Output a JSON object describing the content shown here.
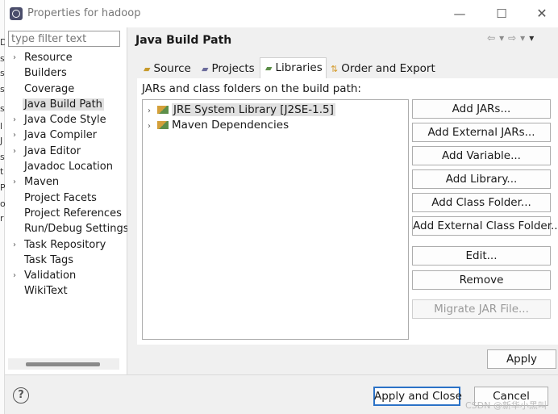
{
  "window": {
    "title": "Properties for hadoop"
  },
  "titlebar_controls": {
    "minimize": "—",
    "maximize": "☐",
    "close": "✕"
  },
  "filter": {
    "placeholder": "type filter text"
  },
  "tree": [
    {
      "label": "Resource",
      "arrow": "›"
    },
    {
      "label": "Builders",
      "arrow": ""
    },
    {
      "label": "Coverage",
      "arrow": ""
    },
    {
      "label": "Java Build Path",
      "arrow": "",
      "selected": true
    },
    {
      "label": "Java Code Style",
      "arrow": "›"
    },
    {
      "label": "Java Compiler",
      "arrow": "›"
    },
    {
      "label": "Java Editor",
      "arrow": "›"
    },
    {
      "label": "Javadoc Location",
      "arrow": ""
    },
    {
      "label": "Maven",
      "arrow": "›"
    },
    {
      "label": "Project Facets",
      "arrow": ""
    },
    {
      "label": "Project References",
      "arrow": ""
    },
    {
      "label": "Run/Debug Settings",
      "arrow": ""
    },
    {
      "label": "Task Repository",
      "arrow": "›"
    },
    {
      "label": "Task Tags",
      "arrow": ""
    },
    {
      "label": "Validation",
      "arrow": "›"
    },
    {
      "label": "WikiText",
      "arrow": ""
    }
  ],
  "page": {
    "title": "Java Build Path"
  },
  "tabs": [
    {
      "label": "Source"
    },
    {
      "label": "Projects"
    },
    {
      "label": "Libraries"
    },
    {
      "label": "Order and Export"
    }
  ],
  "libraries": {
    "label": "JARs and class folders on the build path:",
    "items": [
      {
        "label": "JRE System Library [J2SE-1.5]",
        "selected": true
      },
      {
        "label": "Maven Dependencies"
      }
    ]
  },
  "buttons": {
    "add_jars": "Add JARs...",
    "add_external_jars": "Add External JARs...",
    "add_variable": "Add Variable...",
    "add_library": "Add Library...",
    "add_class_folder": "Add Class Folder...",
    "add_external_class_folder": "Add External Class Folder...",
    "edit": "Edit...",
    "remove": "Remove",
    "migrate_jar": "Migrate JAR File...",
    "apply": "Apply",
    "apply_and_close": "Apply and Close",
    "cancel": "Cancel"
  },
  "help": "?",
  "watermark": "CSDN @新华小黑叫"
}
